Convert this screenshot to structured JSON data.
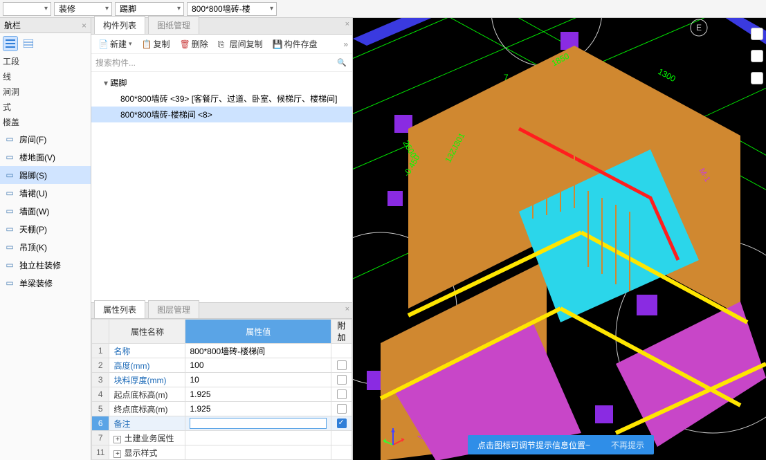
{
  "toolbar": {
    "combo1": "",
    "combo2": "装修",
    "combo3": "踢脚",
    "combo4": "800*800墙砖-楼"
  },
  "nav": {
    "title": "航栏",
    "groups": [
      "工段",
      "线",
      "涧洞",
      "式",
      "楼盖",
      ""
    ],
    "items": [
      {
        "label": "房间(F)",
        "key": "room"
      },
      {
        "label": "楼地面(V)",
        "key": "floor"
      },
      {
        "label": "踢脚(S)",
        "key": "kick",
        "selected": true
      },
      {
        "label": "墙裙(U)",
        "key": "wainscot"
      },
      {
        "label": "墙面(W)",
        "key": "wall"
      },
      {
        "label": "天棚(P)",
        "key": "ceiling"
      },
      {
        "label": "吊顶(K)",
        "key": "suspend"
      },
      {
        "label": "独立柱装修",
        "key": "column"
      },
      {
        "label": "单梁装修",
        "key": "beam"
      }
    ]
  },
  "component_list": {
    "tabs": [
      "构件列表",
      "图纸管理"
    ],
    "active_tab": 0,
    "toolbar": {
      "new": "新建",
      "copy": "复制",
      "delete": "删除",
      "layer_copy": "层间复制",
      "save": "构件存盘"
    },
    "search_placeholder": "搜索构件...",
    "tree": {
      "root": "踢脚",
      "children": [
        {
          "label": "800*800墙砖 <39> [客餐厅、过道、卧室、候梯厅、楼梯间]"
        },
        {
          "label": "800*800墙砖-楼梯间 <8>",
          "selected": true
        }
      ]
    }
  },
  "properties": {
    "tabs": [
      "属性列表",
      "图层管理"
    ],
    "active_tab": 0,
    "headers": {
      "name": "属性名称",
      "value": "属性值",
      "add": "附加"
    },
    "rows": [
      {
        "num": "1",
        "name": "名称",
        "value": "800*800墙砖-楼梯间",
        "blue": true
      },
      {
        "num": "2",
        "name": "高度(mm)",
        "value": "100",
        "blue": true,
        "chk": false
      },
      {
        "num": "3",
        "name": "块料厚度(mm)",
        "value": "10",
        "blue": true,
        "chk": false
      },
      {
        "num": "4",
        "name": "起点底标高(m)",
        "value": "1.925",
        "chk": false
      },
      {
        "num": "5",
        "name": "终点底标高(m)",
        "value": "1.925",
        "chk": false
      },
      {
        "num": "6",
        "name": "备注",
        "value": "",
        "blue": true,
        "chk": true,
        "selected": true,
        "editable": true
      },
      {
        "num": "7",
        "name": "土建业务属性",
        "expand": true
      },
      {
        "num": "11",
        "name": "显示样式",
        "expand": true
      }
    ]
  },
  "viewport": {
    "axis_badge": "E",
    "dims": [
      "1850",
      "1300",
      "2600",
      "-0.450",
      "13ZJ301"
    ],
    "labels": [
      "M-1",
      "M-1",
      "7"
    ],
    "tip": "点击图标可调节提示信息位置~",
    "dismiss": "不再提示"
  }
}
